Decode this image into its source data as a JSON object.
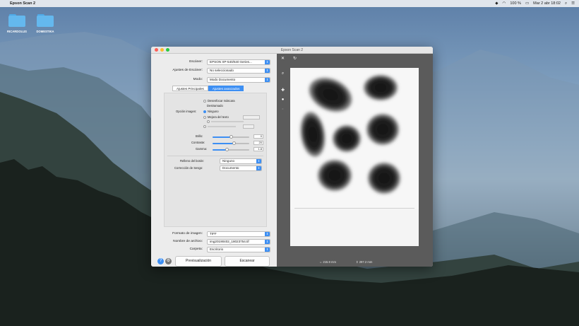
{
  "menubar": {
    "app_name": "Epson Scan 2",
    "clock": "Mar 2 abr 18:02",
    "battery": "100 %"
  },
  "desktop": {
    "icons": [
      {
        "label": "RICARDOLUS"
      },
      {
        "label": "DOMESTIKA"
      }
    ]
  },
  "window": {
    "title": "Epson Scan 2",
    "traffic_colors": [
      "#fe5f57",
      "#febc2e",
      "#28c840"
    ]
  },
  "form": {
    "scanner_label": "Escáner:",
    "scanner_value": "EPSON XP-540/640 Series...",
    "settings_label": "Ajustes de Escáner:",
    "settings_value": "No seleccionado",
    "mode_label": "Modo:",
    "mode_value": "Modo Documento"
  },
  "tabs": [
    {
      "label": "Ajustes Principales",
      "active": false
    },
    {
      "label": "Ajustes avanzados",
      "active": true
    }
  ],
  "advanced": {
    "options_top": [
      "Desenfocar máscara",
      "Destramado"
    ],
    "image_option_label": "Opción imagen:",
    "image_options": [
      {
        "label": "Ninguno",
        "selected": true
      },
      {
        "label": "Mejora del texto",
        "selected": false
      }
    ],
    "brightness_label": "Brillo:",
    "brightness_value": "0",
    "contrast_label": "Contraste:",
    "contrast_value": "20",
    "gamma_label": "Gamma:",
    "gamma_value": "1.8",
    "background_label": "Relleno del borde:",
    "background_value": "Ninguno",
    "skew_label": "Corrección de Sesgo:",
    "skew_value": "Documento"
  },
  "output": {
    "format_label": "Formato de imagen:",
    "format_value": "TIFF",
    "filename_label": "Nombre de archivo:",
    "filename_value": "img20190402_18023754.tif",
    "folder_label": "Carpeta:",
    "folder_value": "Escritorio"
  },
  "buttons": {
    "preview": "Previsualización",
    "scan": "Escanear"
  },
  "preview": {
    "width": "215.9 mm",
    "height": "297.2 mm"
  },
  "colors": {
    "accent": "#3d8ff3",
    "preview_bg": "#5b5b5b"
  }
}
